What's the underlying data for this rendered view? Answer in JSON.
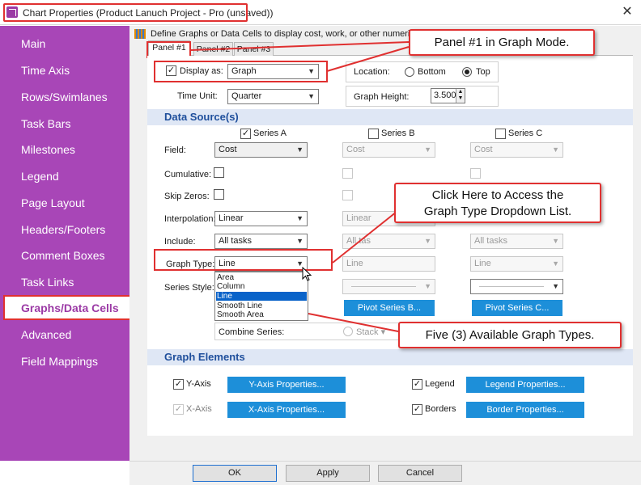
{
  "window": {
    "title": "Chart Properties (Product Lanuch Project - Pro (unsaved))",
    "close_glyph": "✕"
  },
  "sidebar": {
    "items": [
      {
        "label": "Main"
      },
      {
        "label": "Time Axis"
      },
      {
        "label": "Rows/Swimlanes"
      },
      {
        "label": "Task Bars"
      },
      {
        "label": "Milestones"
      },
      {
        "label": "Legend"
      },
      {
        "label": "Page Layout"
      },
      {
        "label": "Headers/Footers"
      },
      {
        "label": "Comment Boxes"
      },
      {
        "label": "Task Links"
      },
      {
        "label": "Graphs/Data Cells"
      },
      {
        "label": "Advanced"
      },
      {
        "label": "Field Mappings"
      }
    ],
    "active_index": 10
  },
  "header": {
    "description": "Define Graphs or Data Cells to display cost, work, or other numeric"
  },
  "tabs": [
    {
      "label": "Panel #1"
    },
    {
      "label": "Panel #2"
    },
    {
      "label": "Panel #3"
    }
  ],
  "settings": {
    "display_as_label": "Display as:",
    "display_as_value": "Graph",
    "location_label": "Location:",
    "bottom_label": "Bottom",
    "top_label": "Top",
    "time_unit_label": "Time Unit:",
    "time_unit_value": "Quarter",
    "graph_height_label": "Graph Height:",
    "graph_height_value": "3.500"
  },
  "data_source": {
    "title": "Data Source(s)",
    "series_headers": [
      "Series A",
      "Series B",
      "Series C"
    ],
    "row_labels": {
      "field": "Field:",
      "cumulative": "Cumulative:",
      "skip_zeros": "Skip Zeros:",
      "interpolation": "Interpolation:",
      "include": "Include:",
      "graph_type": "Graph Type:",
      "series_style": "Series Style:"
    },
    "field_values": [
      "Cost",
      "Cost",
      "Cost"
    ],
    "interpolation_values": [
      "Linear",
      "Linear"
    ],
    "include_values": [
      "All tasks",
      "All tas",
      "All tasks"
    ],
    "graph_type_values": [
      "Line",
      "Line",
      "Line"
    ],
    "pivot_buttons": [
      "Pivot Series B...",
      "Pivot Series C..."
    ],
    "combine_label": "Combine Series:",
    "stack_label": "Stack ▾"
  },
  "dropdown_options": [
    "Area",
    "Column",
    "Line",
    "Smooth Line",
    "Smooth Area"
  ],
  "dropdown_selected": "Line",
  "graph_elements": {
    "title": "Graph Elements",
    "y_axis_label": "Y-Axis",
    "y_axis_button": "Y-Axis Properties...",
    "x_axis_label": "X-Axis",
    "x_axis_button": "X-Axis Properties...",
    "legend_label": "Legend",
    "legend_button": "Legend Properties...",
    "borders_label": "Borders",
    "borders_button": "Border Properties..."
  },
  "callouts": {
    "panel_mode": "Panel #1 in Graph Mode.",
    "dropdown_hint_line1": "Click Here to Access the",
    "dropdown_hint_line2": "Graph Type Dropdown List.",
    "graph_types": "Five (3) Available Graph Types."
  },
  "footer": {
    "ok": "OK",
    "apply": "Apply",
    "cancel": "Cancel"
  },
  "colors": {
    "sidebar": "#a846b7",
    "accent_red": "#e03030",
    "section_blue": "#1f4f9c",
    "button_blue": "#1d8fd9"
  }
}
